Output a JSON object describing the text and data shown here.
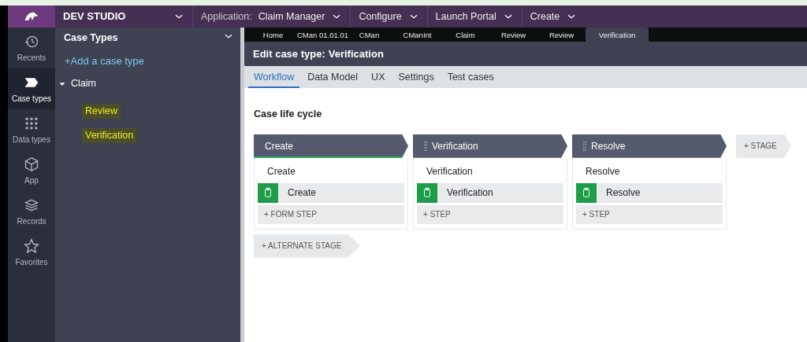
{
  "header": {
    "studio": "DEV STUDIO",
    "menus": [
      {
        "label": "Application:",
        "value": "Claim Manager"
      },
      {
        "label": "Configure"
      },
      {
        "label": "Launch Portal"
      },
      {
        "label": "Create"
      }
    ]
  },
  "nav": [
    {
      "label": "Recents",
      "selected": false
    },
    {
      "label": "Case types",
      "selected": true
    },
    {
      "label": "Data types",
      "selected": false
    },
    {
      "label": "App",
      "selected": false
    },
    {
      "label": "Records",
      "selected": false
    },
    {
      "label": "Favorites",
      "selected": false
    }
  ],
  "panel": {
    "title": "Case Types",
    "add": "+Add a case type",
    "tree": [
      {
        "label": "Claim",
        "expanded": true,
        "children": [
          {
            "label": "Review",
            "highlighted": true
          },
          {
            "label": "Verification",
            "highlighted": true
          }
        ]
      }
    ]
  },
  "doc_tabs": [
    {
      "label": "Home",
      "selected": false
    },
    {
      "label": "CMan 01.01.01",
      "selected": false
    },
    {
      "label": "CMan",
      "selected": false
    },
    {
      "label": "CManInt",
      "selected": false
    },
    {
      "label": "Claim",
      "selected": false
    },
    {
      "label": "Review",
      "selected": false
    },
    {
      "label": "Review",
      "selected": false
    },
    {
      "label": "Verification",
      "selected": true
    }
  ],
  "title": {
    "prefix": "Edit case type:",
    "name": "Verification"
  },
  "tabs": [
    {
      "label": "Workflow",
      "selected": true
    },
    {
      "label": "Data Model",
      "selected": false
    },
    {
      "label": "UX",
      "selected": false
    },
    {
      "label": "Settings",
      "selected": false
    },
    {
      "label": "Test cases",
      "selected": false
    }
  ],
  "lifecycle": {
    "title": "Case life cycle",
    "stages": [
      {
        "name": "Create",
        "selected": true,
        "draggable": false,
        "process": "Create",
        "steps": [
          "Create"
        ],
        "add": "+ FORM STEP"
      },
      {
        "name": "Verification",
        "selected": false,
        "draggable": true,
        "process": "Verification",
        "steps": [
          "Verification"
        ],
        "add": "+ STEP"
      },
      {
        "name": "Resolve",
        "selected": false,
        "draggable": true,
        "process": "Resolve",
        "steps": [
          "Resolve"
        ],
        "add": "+ STEP"
      }
    ],
    "add_stage": "+ STAGE",
    "add_alternate": "+ ALTERNATE STAGE"
  }
}
